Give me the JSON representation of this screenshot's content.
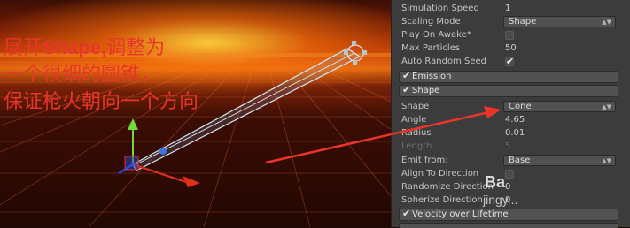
{
  "annotation": {
    "line1_a": "展开",
    "line1_b": "Shape,",
    "line1_c": "调整为",
    "line2": "一个很细的圆锥，",
    "line3": "保证枪火朝向一个方向"
  },
  "inspector": {
    "rows": {
      "sim_speed": {
        "label": "Simulation Speed",
        "value": "1"
      },
      "scaling": {
        "label": "Scaling Mode",
        "value": "Shape"
      },
      "play_awake": {
        "label": "Play On Awake*"
      },
      "max_particles": {
        "label": "Max Particles",
        "value": "50"
      },
      "auto_seed": {
        "label": "Auto Random Seed"
      }
    },
    "modules": {
      "emission": "Emission",
      "shape": "Shape",
      "velocity": "Velocity over Lifetime"
    },
    "shape": {
      "shape": {
        "label": "Shape",
        "value": "Cone"
      },
      "angle": {
        "label": "Angle",
        "value": "4.65"
      },
      "radius": {
        "label": "Radius",
        "value": "0.01"
      },
      "length": {
        "label": "Length",
        "value": "5"
      },
      "emit_from": {
        "label": "Emit from:",
        "value": "Base"
      },
      "align": {
        "label": "Align To Direction"
      },
      "randomize": {
        "label": "Randomize Direction",
        "value": "0"
      },
      "spherize": {
        "label": "Spherize Direction",
        "value": "0"
      }
    }
  },
  "watermark": {
    "line1": "Ba",
    "line2": "jingy..."
  },
  "colors": {
    "annotation": "#e8352a",
    "arrow": "#e8352a",
    "inspector_bg": "#3c3c3c"
  }
}
